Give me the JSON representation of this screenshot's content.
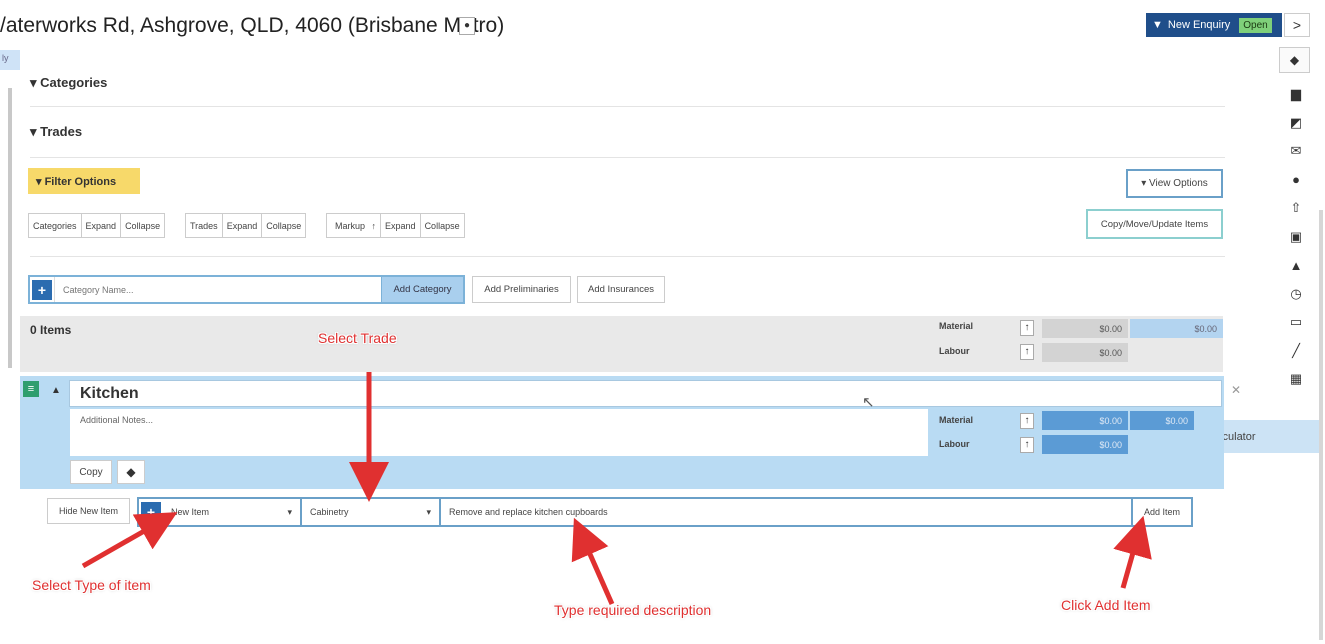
{
  "header": {
    "address": "/aterworks Rd, Ashgrove, QLD, 4060 (Brisbane Metro)",
    "pin_icon": "map-pin-icon",
    "crumb_chip": "ly",
    "enquiry_label": "New Enquiry",
    "enquiry_status": "Open",
    "next_label": ">"
  },
  "sections": {
    "categories": "Categories",
    "trades": "Trades"
  },
  "filter": {
    "label": "Filter Options",
    "view_options": "View Options",
    "copy_move": "Copy/Move/Update Items",
    "groups": [
      {
        "label": "Categories",
        "expand": "Expand",
        "collapse": "Collapse"
      },
      {
        "label": "Trades",
        "expand": "Expand",
        "collapse": "Collapse"
      },
      {
        "label": "Markup",
        "expand": "Expand",
        "collapse": "Collapse"
      }
    ]
  },
  "add_category": {
    "placeholder": "Category Name...",
    "button": "Add Category",
    "preliminaries": "Add Preliminaries",
    "insurances": "Add Insurances"
  },
  "summary": {
    "title": "0 Items",
    "material_label": "Material",
    "labour_label": "Labour",
    "material_value": "$0.00",
    "labour_value": "$0.00",
    "total_value": "$0.00"
  },
  "kitchen": {
    "name": "Kitchen",
    "notes_placeholder": "Additional Notes...",
    "material_label": "Material",
    "labour_label": "Labour",
    "material_value": "$0.00",
    "labour_value": "$0.00",
    "total_value": "$0.00",
    "copy": "Copy"
  },
  "calculator": {
    "label": "Calculator"
  },
  "new_item": {
    "hide": "Hide New Item",
    "type": "New Item",
    "trade": "Cabinetry",
    "description": "Remove and replace kitchen cupboards",
    "add": "Add Item"
  },
  "annotations": {
    "select_trade": "Select Trade",
    "select_type": "Select Type of item",
    "type_description": "Type required description",
    "click_add": "Click Add Item"
  },
  "rail_icons": [
    "sticky-note-icon",
    "edit-icon",
    "envelope-icon",
    "comment-icon",
    "upload-icon",
    "contact-card-icon",
    "bell-icon",
    "clock-icon",
    "image-icon",
    "brush-icon",
    "calculator-icon"
  ],
  "colors": {
    "accent": "#1f4e8a",
    "status_open": "#7fd07a",
    "panel": "#b9dbf3",
    "filter": "#f7d96a",
    "annotation": "#e03030"
  }
}
